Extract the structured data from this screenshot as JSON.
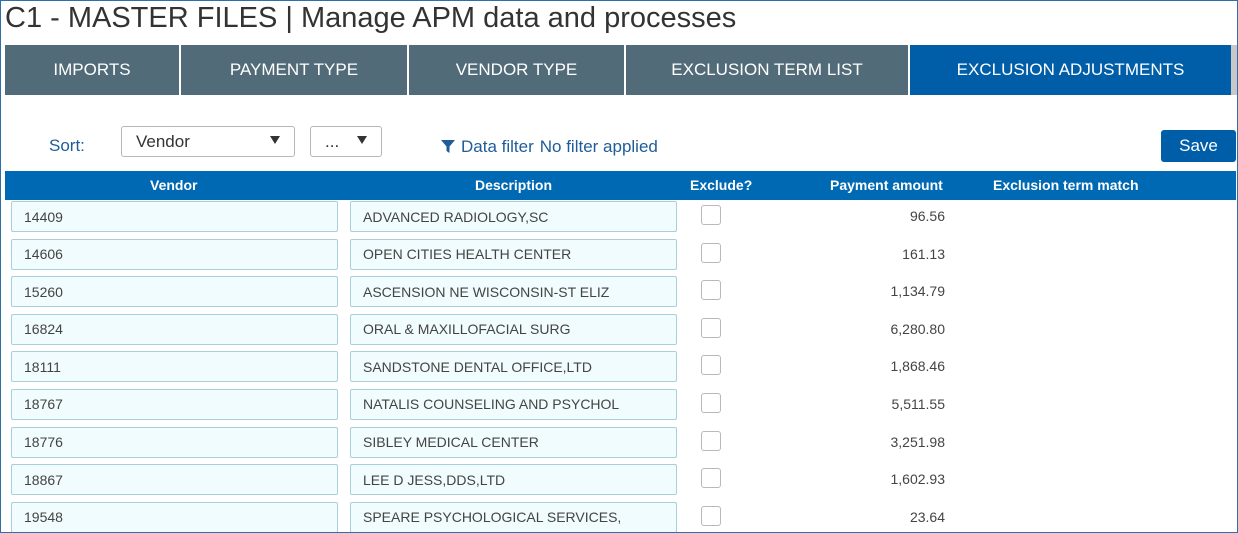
{
  "page": {
    "title": "C1 - MASTER FILES | Manage APM data and processes"
  },
  "tabs": [
    {
      "label": "IMPORTS",
      "active": false
    },
    {
      "label": "PAYMENT TYPE",
      "active": false
    },
    {
      "label": "VENDOR TYPE",
      "active": false
    },
    {
      "label": "EXCLUSION TERM LIST",
      "active": false
    },
    {
      "label": "EXCLUSION ADJUSTMENTS",
      "active": true
    }
  ],
  "toolbar": {
    "sort_label": "Sort:",
    "sort_value": "Vendor",
    "sort_direction_value": "...",
    "filter_label": "Data filter",
    "filter_status": "No filter applied",
    "save_label": "Save"
  },
  "grid": {
    "headers": {
      "vendor": "Vendor",
      "description": "Description",
      "exclude": "Exclude?",
      "payment_amount": "Payment amount",
      "exclusion_term_match": "Exclusion term match"
    },
    "rows": [
      {
        "vendor": "14409",
        "description": "ADVANCED RADIOLOGY,SC",
        "exclude": false,
        "payment": "96.56"
      },
      {
        "vendor": "14606",
        "description": "OPEN CITIES HEALTH CENTER",
        "exclude": false,
        "payment": "161.13"
      },
      {
        "vendor": "15260",
        "description": "ASCENSION NE WISCONSIN-ST ELIZ",
        "exclude": false,
        "payment": "1,134.79"
      },
      {
        "vendor": "16824",
        "description": "ORAL & MAXILLOFACIAL SURG",
        "exclude": false,
        "payment": "6,280.80"
      },
      {
        "vendor": "18111",
        "description": "SANDSTONE DENTAL OFFICE,LTD",
        "exclude": false,
        "payment": "1,868.46"
      },
      {
        "vendor": "18767",
        "description": "NATALIS COUNSELING AND PSYCHOL",
        "exclude": false,
        "payment": "5,511.55"
      },
      {
        "vendor": "18776",
        "description": "SIBLEY MEDICAL CENTER",
        "exclude": false,
        "payment": "3,251.98"
      },
      {
        "vendor": "18867",
        "description": "LEE D JESS,DDS,LTD",
        "exclude": false,
        "payment": "1,602.93"
      },
      {
        "vendor": "19548",
        "description": "SPEARE PSYCHOLOGICAL SERVICES,",
        "exclude": false,
        "payment": "23.64"
      }
    ]
  },
  "icons": {
    "filter": "funnel-icon",
    "dropdown": "caret-down-icon"
  },
  "colors": {
    "tab_inactive": "#526b78",
    "tab_active": "#005da8",
    "header_bg": "#0069b4",
    "cell_bg": "#f1fcfe",
    "link": "#1f5c99"
  }
}
